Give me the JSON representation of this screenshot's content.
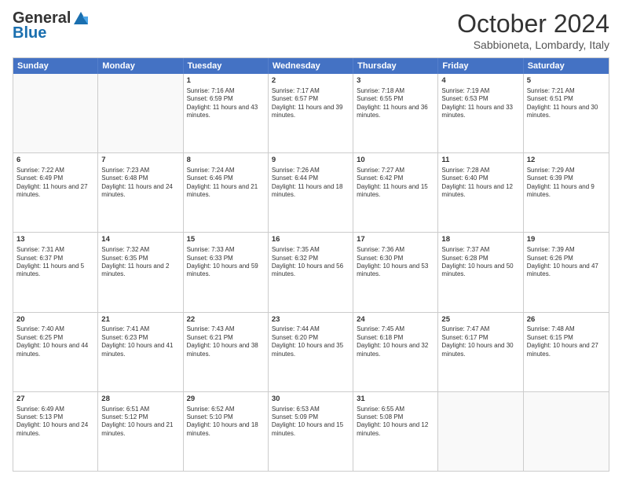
{
  "header": {
    "logo_general": "General",
    "logo_blue": "Blue",
    "month_title": "October 2024",
    "subtitle": "Sabbioneta, Lombardy, Italy"
  },
  "days_of_week": [
    "Sunday",
    "Monday",
    "Tuesday",
    "Wednesday",
    "Thursday",
    "Friday",
    "Saturday"
  ],
  "weeks": [
    [
      {
        "day": "",
        "empty": true
      },
      {
        "day": "",
        "empty": true
      },
      {
        "day": "1",
        "sunrise": "Sunrise: 7:16 AM",
        "sunset": "Sunset: 6:59 PM",
        "daylight": "Daylight: 11 hours and 43 minutes."
      },
      {
        "day": "2",
        "sunrise": "Sunrise: 7:17 AM",
        "sunset": "Sunset: 6:57 PM",
        "daylight": "Daylight: 11 hours and 39 minutes."
      },
      {
        "day": "3",
        "sunrise": "Sunrise: 7:18 AM",
        "sunset": "Sunset: 6:55 PM",
        "daylight": "Daylight: 11 hours and 36 minutes."
      },
      {
        "day": "4",
        "sunrise": "Sunrise: 7:19 AM",
        "sunset": "Sunset: 6:53 PM",
        "daylight": "Daylight: 11 hours and 33 minutes."
      },
      {
        "day": "5",
        "sunrise": "Sunrise: 7:21 AM",
        "sunset": "Sunset: 6:51 PM",
        "daylight": "Daylight: 11 hours and 30 minutes."
      }
    ],
    [
      {
        "day": "6",
        "sunrise": "Sunrise: 7:22 AM",
        "sunset": "Sunset: 6:49 PM",
        "daylight": "Daylight: 11 hours and 27 minutes."
      },
      {
        "day": "7",
        "sunrise": "Sunrise: 7:23 AM",
        "sunset": "Sunset: 6:48 PM",
        "daylight": "Daylight: 11 hours and 24 minutes."
      },
      {
        "day": "8",
        "sunrise": "Sunrise: 7:24 AM",
        "sunset": "Sunset: 6:46 PM",
        "daylight": "Daylight: 11 hours and 21 minutes."
      },
      {
        "day": "9",
        "sunrise": "Sunrise: 7:26 AM",
        "sunset": "Sunset: 6:44 PM",
        "daylight": "Daylight: 11 hours and 18 minutes."
      },
      {
        "day": "10",
        "sunrise": "Sunrise: 7:27 AM",
        "sunset": "Sunset: 6:42 PM",
        "daylight": "Daylight: 11 hours and 15 minutes."
      },
      {
        "day": "11",
        "sunrise": "Sunrise: 7:28 AM",
        "sunset": "Sunset: 6:40 PM",
        "daylight": "Daylight: 11 hours and 12 minutes."
      },
      {
        "day": "12",
        "sunrise": "Sunrise: 7:29 AM",
        "sunset": "Sunset: 6:39 PM",
        "daylight": "Daylight: 11 hours and 9 minutes."
      }
    ],
    [
      {
        "day": "13",
        "sunrise": "Sunrise: 7:31 AM",
        "sunset": "Sunset: 6:37 PM",
        "daylight": "Daylight: 11 hours and 5 minutes."
      },
      {
        "day": "14",
        "sunrise": "Sunrise: 7:32 AM",
        "sunset": "Sunset: 6:35 PM",
        "daylight": "Daylight: 11 hours and 2 minutes."
      },
      {
        "day": "15",
        "sunrise": "Sunrise: 7:33 AM",
        "sunset": "Sunset: 6:33 PM",
        "daylight": "Daylight: 10 hours and 59 minutes."
      },
      {
        "day": "16",
        "sunrise": "Sunrise: 7:35 AM",
        "sunset": "Sunset: 6:32 PM",
        "daylight": "Daylight: 10 hours and 56 minutes."
      },
      {
        "day": "17",
        "sunrise": "Sunrise: 7:36 AM",
        "sunset": "Sunset: 6:30 PM",
        "daylight": "Daylight: 10 hours and 53 minutes."
      },
      {
        "day": "18",
        "sunrise": "Sunrise: 7:37 AM",
        "sunset": "Sunset: 6:28 PM",
        "daylight": "Daylight: 10 hours and 50 minutes."
      },
      {
        "day": "19",
        "sunrise": "Sunrise: 7:39 AM",
        "sunset": "Sunset: 6:26 PM",
        "daylight": "Daylight: 10 hours and 47 minutes."
      }
    ],
    [
      {
        "day": "20",
        "sunrise": "Sunrise: 7:40 AM",
        "sunset": "Sunset: 6:25 PM",
        "daylight": "Daylight: 10 hours and 44 minutes."
      },
      {
        "day": "21",
        "sunrise": "Sunrise: 7:41 AM",
        "sunset": "Sunset: 6:23 PM",
        "daylight": "Daylight: 10 hours and 41 minutes."
      },
      {
        "day": "22",
        "sunrise": "Sunrise: 7:43 AM",
        "sunset": "Sunset: 6:21 PM",
        "daylight": "Daylight: 10 hours and 38 minutes."
      },
      {
        "day": "23",
        "sunrise": "Sunrise: 7:44 AM",
        "sunset": "Sunset: 6:20 PM",
        "daylight": "Daylight: 10 hours and 35 minutes."
      },
      {
        "day": "24",
        "sunrise": "Sunrise: 7:45 AM",
        "sunset": "Sunset: 6:18 PM",
        "daylight": "Daylight: 10 hours and 32 minutes."
      },
      {
        "day": "25",
        "sunrise": "Sunrise: 7:47 AM",
        "sunset": "Sunset: 6:17 PM",
        "daylight": "Daylight: 10 hours and 30 minutes."
      },
      {
        "day": "26",
        "sunrise": "Sunrise: 7:48 AM",
        "sunset": "Sunset: 6:15 PM",
        "daylight": "Daylight: 10 hours and 27 minutes."
      }
    ],
    [
      {
        "day": "27",
        "sunrise": "Sunrise: 6:49 AM",
        "sunset": "Sunset: 5:13 PM",
        "daylight": "Daylight: 10 hours and 24 minutes."
      },
      {
        "day": "28",
        "sunrise": "Sunrise: 6:51 AM",
        "sunset": "Sunset: 5:12 PM",
        "daylight": "Daylight: 10 hours and 21 minutes."
      },
      {
        "day": "29",
        "sunrise": "Sunrise: 6:52 AM",
        "sunset": "Sunset: 5:10 PM",
        "daylight": "Daylight: 10 hours and 18 minutes."
      },
      {
        "day": "30",
        "sunrise": "Sunrise: 6:53 AM",
        "sunset": "Sunset: 5:09 PM",
        "daylight": "Daylight: 10 hours and 15 minutes."
      },
      {
        "day": "31",
        "sunrise": "Sunrise: 6:55 AM",
        "sunset": "Sunset: 5:08 PM",
        "daylight": "Daylight: 10 hours and 12 minutes."
      },
      {
        "day": "",
        "empty": true
      },
      {
        "day": "",
        "empty": true
      }
    ]
  ]
}
